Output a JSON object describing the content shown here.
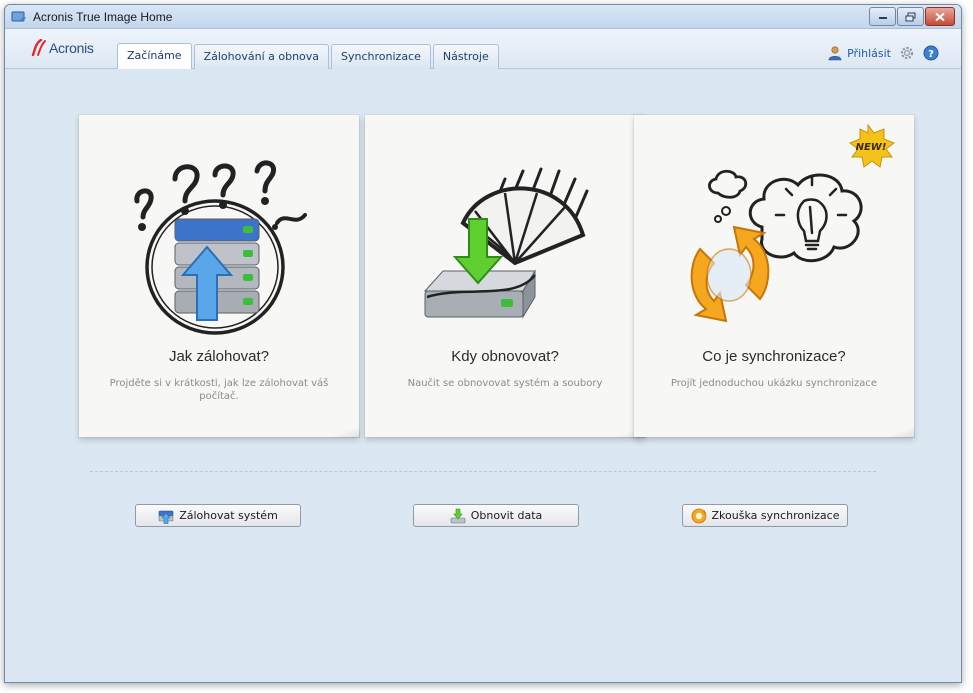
{
  "window": {
    "title": "Acronis True Image Home"
  },
  "brand": {
    "logo_text": "Acronis"
  },
  "tabs": [
    {
      "label": "Začínáme",
      "active": true
    },
    {
      "label": "Zálohování a obnova",
      "active": false
    },
    {
      "label": "Synchronizace",
      "active": false
    },
    {
      "label": "Nástroje",
      "active": false
    }
  ],
  "header_right": {
    "login_label": "Přihlásit",
    "icons": [
      "user-icon",
      "gear-icon",
      "help-icon"
    ]
  },
  "cards": [
    {
      "title": "Jak zálohovat?",
      "description": "Projděte si v krátkosti, jak lze zálohovat váš počítač.",
      "icon": "backup-question-illustration"
    },
    {
      "title": "Kdy obnovovat?",
      "description": "Naučit se obnovovat systém a soubory",
      "icon": "restore-umbrella-illustration"
    },
    {
      "title": "Co je synchronizace?",
      "description": "Projít jednoduchou ukázku synchronizace",
      "icon": "sync-lightbulb-illustration",
      "badge": "NEW!"
    }
  ],
  "buttons": [
    {
      "label": "Zálohovat systém",
      "icon": "backup-icon"
    },
    {
      "label": "Obnovit data",
      "icon": "restore-icon"
    },
    {
      "label": "Zkouška synchronizace",
      "icon": "sync-icon"
    }
  ],
  "colors": {
    "accent": "#1f5aa8",
    "background": "#dbe7f2",
    "card": "#f7f7f5",
    "new_badge": "#f5c21b"
  }
}
